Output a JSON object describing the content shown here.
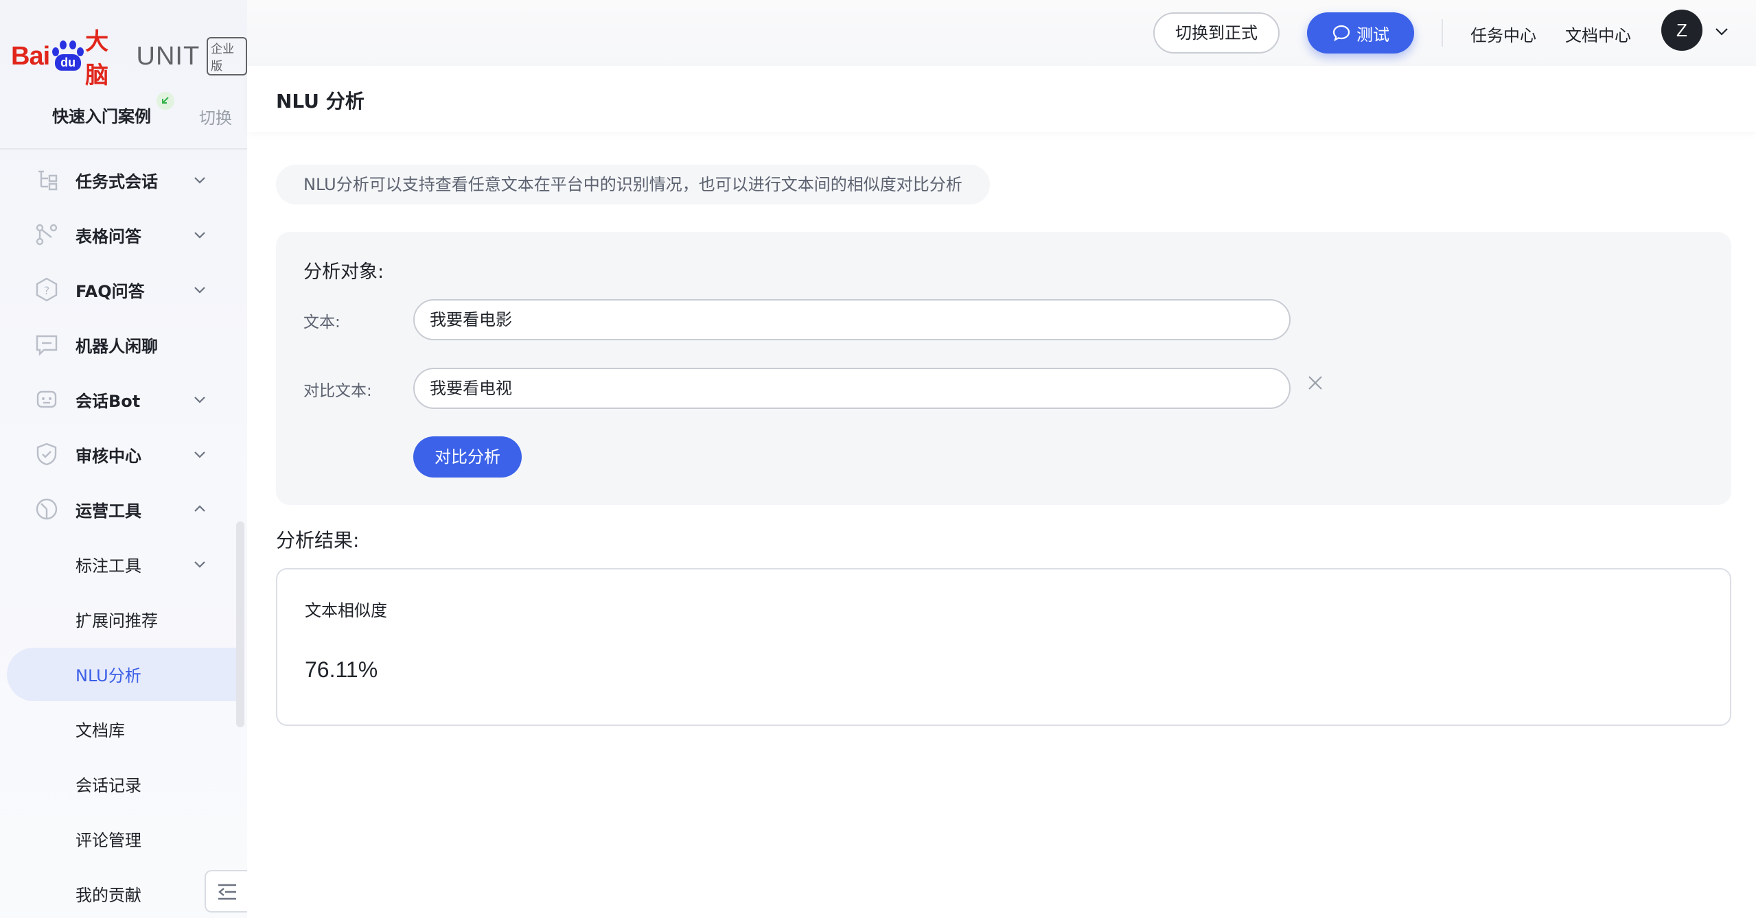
{
  "logo": {
    "bai": "Bai",
    "du": "du",
    "danao": "大脑",
    "unit": "UNIT",
    "badge": "企业版"
  },
  "sidebar": {
    "quick_start": "快速入门案例",
    "switch": "切换",
    "items": [
      {
        "label": "任务式会话"
      },
      {
        "label": "表格问答"
      },
      {
        "label": "FAQ问答"
      },
      {
        "label": "机器人闲聊"
      },
      {
        "label": "会话Bot"
      },
      {
        "label": "审核中心"
      },
      {
        "label": "运营工具"
      },
      {
        "label": "标注工具"
      },
      {
        "label": "扩展问推荐"
      },
      {
        "label": "NLU分析"
      },
      {
        "label": "文档库"
      },
      {
        "label": "会话记录"
      },
      {
        "label": "评论管理"
      },
      {
        "label": "我的贡献"
      }
    ]
  },
  "topbar": {
    "switch_label": "切换到正式",
    "test_label": "测试",
    "task_center": "任务中心",
    "doc_center": "文档中心",
    "avatar_initial": "Z"
  },
  "page": {
    "title": "NLU 分析",
    "notice": "NLU分析可以支持查看任意文本在平台中的识别情况，也可以进行文本间的相似度对比分析",
    "analysis_target": "分析对象:",
    "text_label": "文本:",
    "text_value": "我要看电影",
    "compare_label": "对比文本:",
    "compare_value": "我要看电视",
    "compare_button": "对比分析",
    "result_title": "分析结果:",
    "similarity_label": "文本相似度",
    "similarity_value": "76.11%"
  },
  "colors": {
    "accent": "#3b62e8",
    "brand_red": "#e1251b",
    "brand_blue": "#2932e1"
  }
}
